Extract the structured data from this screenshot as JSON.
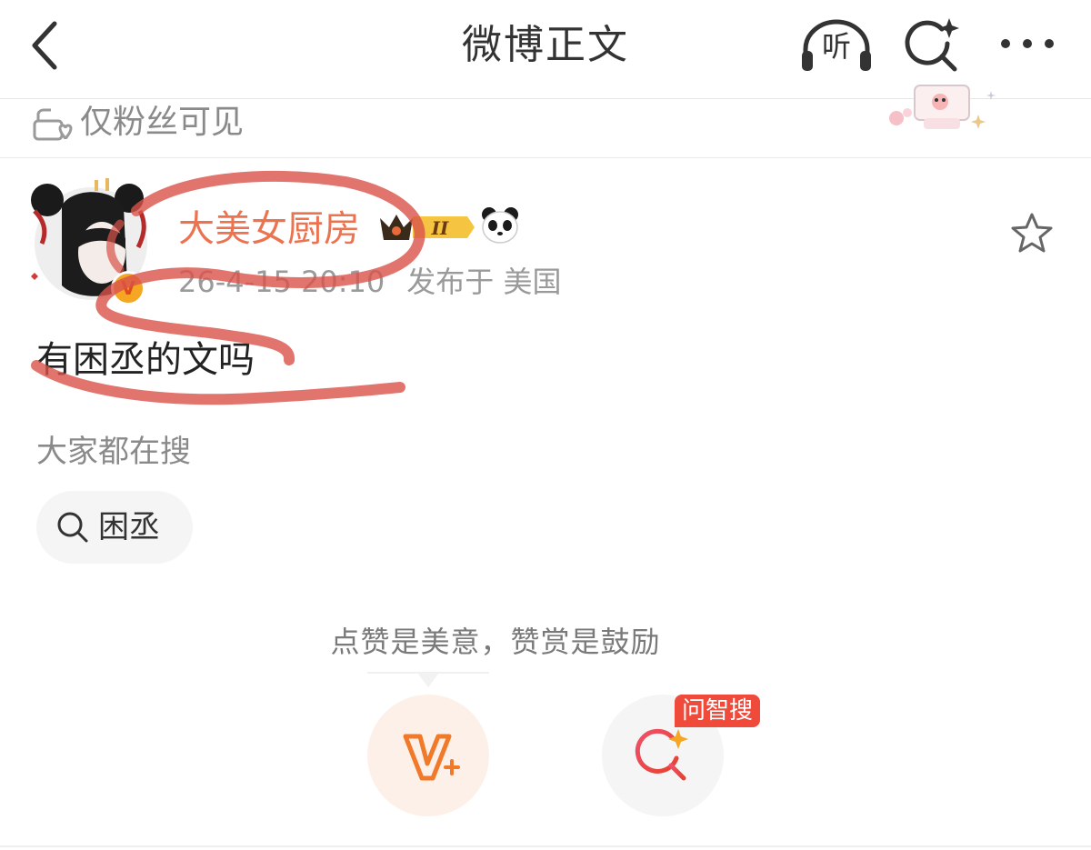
{
  "navbar": {
    "title": "微博正文",
    "listen_label": "听",
    "icons": [
      "back-arrow-icon",
      "headphones-icon",
      "ai-search-icon",
      "more-dots-icon"
    ]
  },
  "visibility": {
    "text": "仅粉丝可见",
    "icon": "fans-only-lock-icon"
  },
  "post": {
    "username": "大美女厨房",
    "verified_badge": "V",
    "level_badge": "II",
    "time": "26-4-15 20:10",
    "location": "发布于 美国",
    "text": "有困丞的文吗"
  },
  "hot_search": {
    "label": "大家都在搜",
    "chip": "困丞"
  },
  "actions": {
    "reward_slogan": "点赞是美意，赞赏是鼓励",
    "ask_badge": "问智搜"
  },
  "colors": {
    "username": "#eb7350",
    "marker": "#d9534a",
    "reward_bg": "#fdf0e8",
    "badge": "#f04a3a"
  }
}
